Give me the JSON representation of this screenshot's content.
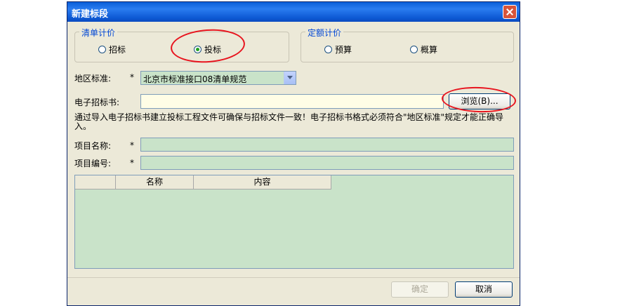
{
  "dialog": {
    "title": "新建标段"
  },
  "list_pricing": {
    "legend": "清单计价",
    "options": [
      {
        "label": "招标",
        "selected": false
      },
      {
        "label": "投标",
        "selected": true
      }
    ]
  },
  "quota_pricing": {
    "legend": "定额计价",
    "options": [
      {
        "label": "预算",
        "selected": false
      },
      {
        "label": "概算",
        "selected": false
      }
    ]
  },
  "region": {
    "label": "地区标准:",
    "required_mark": "*",
    "value": "北京市标准接口08清单规范"
  },
  "e_tender": {
    "label": "电子招标书:",
    "value": "",
    "browse_label": "浏览(B)..."
  },
  "info_text": "通过导入电子招标书建立投标工程文件可确保与招标文件一致！电子招标书格式必须符合\"地区标准\"规定才能正确导入。",
  "project_name": {
    "label": "项目名称:",
    "required_mark": "*",
    "value": ""
  },
  "project_code": {
    "label": "项目编号:",
    "required_mark": "*",
    "value": ""
  },
  "table": {
    "columns": [
      "",
      "名称",
      "内容"
    ],
    "rows": []
  },
  "footer": {
    "ok_label": "确定",
    "ok_enabled": false,
    "cancel_label": "取消"
  },
  "colors": {
    "title_bar": "#0a5fd8",
    "dialog_bg": "#ece9d8",
    "field_green": "#c9e3c9",
    "field_yellow": "#fffde6",
    "annotation_red": "#e8141e"
  }
}
